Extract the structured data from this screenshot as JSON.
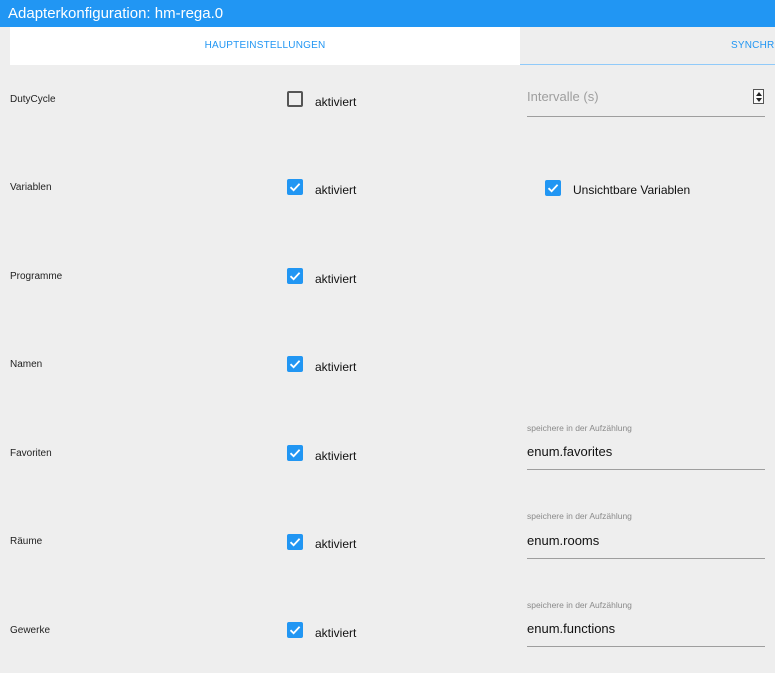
{
  "window": {
    "title": "Adapterkonfiguration: hm-rega.0"
  },
  "tabs": [
    {
      "label": "HAUPTEINSTELLUNGEN",
      "active": true
    },
    {
      "label": "SYNCHR",
      "active": false
    }
  ],
  "rows": [
    {
      "label": "DutyCycle",
      "checkbox_label": "aktiviert",
      "checked": false
    },
    {
      "label": "Variablen",
      "checkbox_label": "aktiviert",
      "checked": true
    },
    {
      "label": "Programme",
      "checkbox_label": "aktiviert",
      "checked": true
    },
    {
      "label": "Namen",
      "checkbox_label": "aktiviert",
      "checked": true
    },
    {
      "label": "Favoriten",
      "checkbox_label": "aktiviert",
      "checked": true
    },
    {
      "label": "Räume",
      "checkbox_label": "aktiviert",
      "checked": true
    },
    {
      "label": "Gewerke",
      "checkbox_label": "aktiviert",
      "checked": true
    }
  ],
  "interval_field": {
    "placeholder": "Intervalle (s)"
  },
  "invisible_variables": {
    "label": "Unsichtbare Variablen",
    "checked": true
  },
  "enum_fields": [
    {
      "caption": "speichere in der Aufzählung",
      "value": "enum.favorites"
    },
    {
      "caption": "speichere in der Aufzählung",
      "value": "enum.rooms"
    },
    {
      "caption": "speichere in der Aufzählung",
      "value": "enum.functions"
    }
  ],
  "colors": {
    "accent": "#2196f3",
    "background": "#eeeeee"
  }
}
